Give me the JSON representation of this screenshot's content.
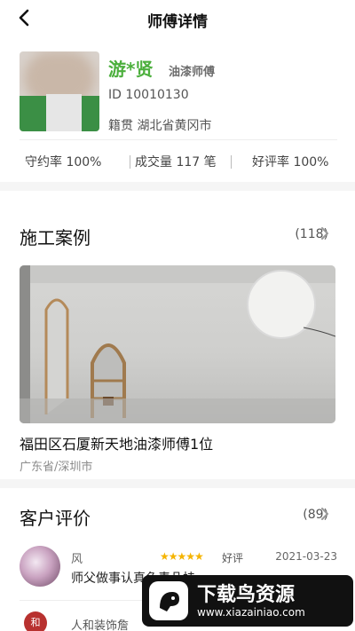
{
  "header": {
    "title": "师傅详情",
    "back_icon": "back-arrow-icon"
  },
  "profile": {
    "name": "游*贤",
    "role": "油漆师傅",
    "id_text": "ID 10010130",
    "hometown_text": "籍贯 湖北省黄冈市"
  },
  "stats": [
    {
      "label": "守约率 100%"
    },
    {
      "label": "成交量 117 笔"
    },
    {
      "label": "好评率 100%"
    }
  ],
  "cases": {
    "title": "施工案例",
    "count": "(118)",
    "item": {
      "title": "福田区石厦新天地油漆师傅1位",
      "location": "广东省/深圳市"
    }
  },
  "reviews": {
    "title": "客户评价",
    "count": "(89)",
    "items": [
      {
        "name": "风",
        "stars": "★★★★★",
        "rating": 5,
        "rating_text": "好评",
        "date": "2021-03-23",
        "text": "师父做事认真负责几挂"
      },
      {
        "name": "人和装饰詹",
        "avatar_text": "和"
      }
    ]
  },
  "watermark": {
    "title": "下载鸟资源",
    "url": "www.xiazainiao.com"
  },
  "colors": {
    "accent_green": "#4caf3d",
    "star": "#f5b400"
  }
}
